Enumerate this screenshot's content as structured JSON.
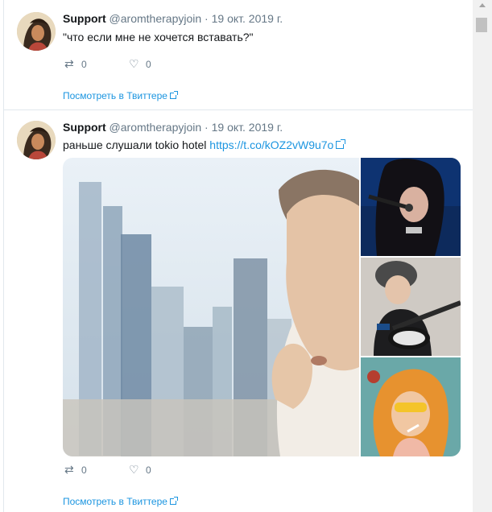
{
  "tweets": [
    {
      "name": "Support",
      "handle": "@aromtherapyjoin",
      "separator": "·",
      "date": "19 окт. 2019 г.",
      "text": "\"что если мне не хочется вставать?\"",
      "link": "",
      "retweets": "0",
      "likes": "0",
      "view_link": "Посмотреть в Твиттере"
    },
    {
      "name": "Support",
      "handle": "@aromtherapyjoin",
      "separator": "·",
      "date": "19 окт. 2019 г.",
      "text": "раньше слушали tokio hotel",
      "link": "https://t.co/kOZ2vW9u7o",
      "retweets": "0",
      "likes": "0",
      "view_link": "Посмотреть в Твиттере"
    }
  ],
  "icons": {
    "retweet": "retweet-icon",
    "like": "heart-icon",
    "external": "external-link-icon"
  },
  "colors": {
    "link": "#1b95e0",
    "secondary_text": "#657786",
    "border": "#e1e8ed"
  }
}
